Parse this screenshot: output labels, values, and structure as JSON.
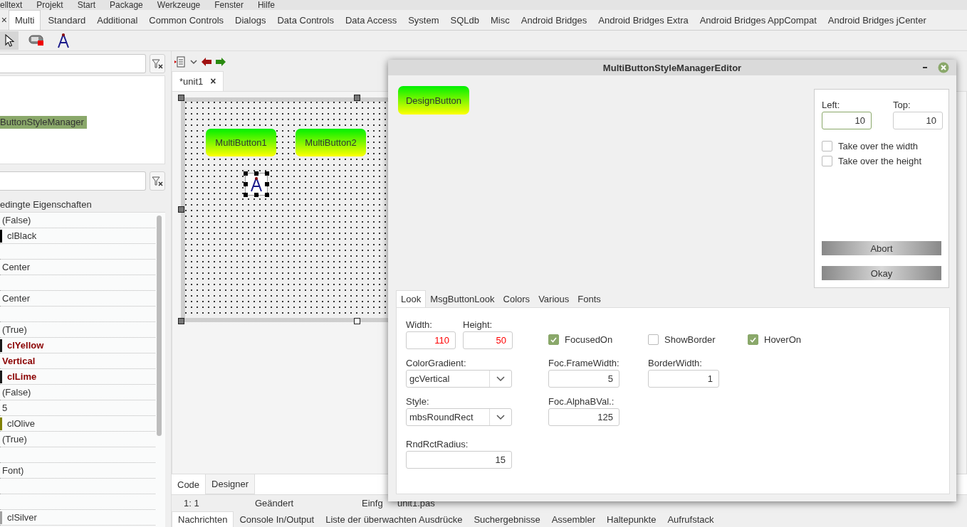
{
  "menu": [
    "elltext",
    "Projekt",
    "Start",
    "Package",
    "Werkzeuge",
    "Fenster",
    "Hilfe"
  ],
  "palette": {
    "close": "×",
    "tabs": [
      {
        "label": "Multi",
        "selected": true
      },
      {
        "label": "Standard",
        "selected": false
      },
      {
        "label": "Additional",
        "selected": false
      },
      {
        "label": "Common Controls",
        "selected": false
      },
      {
        "label": "Dialogs",
        "selected": false
      },
      {
        "label": "Data Controls",
        "selected": false
      },
      {
        "label": "Data Access",
        "selected": false
      },
      {
        "label": "System",
        "selected": false
      },
      {
        "label": "SQLdb",
        "selected": false
      },
      {
        "label": "Misc",
        "selected": false
      },
      {
        "label": "Android Bridges",
        "selected": false
      },
      {
        "label": "Android Bridges Extra",
        "selected": false
      },
      {
        "label": "Android Bridges AppCompat",
        "selected": false
      },
      {
        "label": "Android Bridges jCenter",
        "selected": false
      }
    ],
    "tools": [
      {
        "kind": "pointer",
        "selected": true
      },
      {
        "kind": "switch",
        "selected": false
      },
      {
        "kind": "compass",
        "selected": false
      }
    ]
  },
  "inspector": {
    "tree": [
      {
        "label": "ButtonStyleManager",
        "selected": true
      }
    ],
    "caption": "edingte Eigenschaften",
    "properties": [
      {
        "kind": "value",
        "value": "(False)",
        "modified": false
      },
      {
        "kind": "color",
        "value": "clBlack",
        "modified": false,
        "color": "#000000"
      },
      {
        "kind": "blank"
      },
      {
        "kind": "value",
        "value": "Center",
        "modified": false
      },
      {
        "kind": "blank"
      },
      {
        "kind": "value",
        "value": "Center",
        "modified": false
      },
      {
        "kind": "blank"
      },
      {
        "kind": "value",
        "value": "(True)",
        "modified": false
      },
      {
        "kind": "color",
        "value": "clYellow",
        "modified": true,
        "color": "#1a1a1a"
      },
      {
        "kind": "value",
        "value": "Vertical",
        "modified": true
      },
      {
        "kind": "color",
        "value": "clLime",
        "modified": true,
        "color": "#1a1a1a"
      },
      {
        "kind": "value",
        "value": "(False)",
        "modified": false
      },
      {
        "kind": "value",
        "value": "5",
        "modified": false
      },
      {
        "kind": "color",
        "value": "clOlive",
        "modified": false,
        "color": "#808000"
      },
      {
        "kind": "value",
        "value": "(True)",
        "modified": false
      },
      {
        "kind": "blank"
      },
      {
        "kind": "value",
        "value": "Font)",
        "modified": false
      },
      {
        "kind": "blank"
      },
      {
        "kind": "blank"
      },
      {
        "kind": "color",
        "value": "clSilver",
        "modified": false,
        "color": "#a0a0a0"
      }
    ]
  },
  "editor": {
    "tabs": [
      {
        "label": "*unit1",
        "close": "×",
        "selected": true
      }
    ],
    "form_buttons": [
      "MultiButton1",
      "MultiButton2"
    ],
    "view_tabs": [
      {
        "label": "Code",
        "selected": false
      },
      {
        "label": "Designer",
        "selected": true
      }
    ],
    "status": [
      "1:  1",
      "Geändert",
      "Einfg",
      "unit1.pas"
    ]
  },
  "messages_tabs": [
    {
      "label": "Nachrichten",
      "selected": true
    },
    {
      "label": "Console In/Output",
      "selected": false
    },
    {
      "label": "Liste der überwachten Ausdrücke",
      "selected": false
    },
    {
      "label": "Suchergebnisse",
      "selected": false
    },
    {
      "label": "Assembler",
      "selected": false
    },
    {
      "label": "Haltepunkte",
      "selected": false
    },
    {
      "label": "Aufrufstack",
      "selected": false
    }
  ],
  "dialog": {
    "title": "MultiButtonStyleManagerEditor",
    "design_button": "DesignButton",
    "position": [
      {
        "label": "Left:",
        "value": "10",
        "focused": true
      },
      {
        "label": "Top:",
        "value": "10",
        "focused": false
      }
    ],
    "options": [
      {
        "label": "Take over the width",
        "checked": false
      },
      {
        "label": "Take over the height",
        "checked": false
      }
    ],
    "actions": [
      "Abort",
      "Okay"
    ],
    "tabs": [
      {
        "label": "Look",
        "selected": true
      },
      {
        "label": "MsgButtonLook",
        "selected": false
      },
      {
        "label": "Colors",
        "selected": false
      },
      {
        "label": "Various",
        "selected": false
      },
      {
        "label": "Fonts",
        "selected": false
      }
    ],
    "look_rows": [
      [
        {
          "kind": "pair",
          "fields": [
            {
              "label": "Width:",
              "value": "110",
              "alert": true
            },
            {
              "label": "Height:",
              "value": "50",
              "alert": true
            }
          ]
        },
        {
          "kind": "check",
          "label": "FocusedOn",
          "checked": true
        },
        {
          "kind": "check",
          "label": "ShowBorder",
          "checked": false
        },
        {
          "kind": "check",
          "label": "HoverOn",
          "checked": true
        }
      ],
      [
        {
          "kind": "combo",
          "label": "ColorGradient:",
          "value": "gcVertical"
        },
        {
          "kind": "number",
          "label": "Foc.FrameWidth:",
          "value": "5",
          "alert": false
        },
        {
          "kind": "number",
          "label": "BorderWidth:",
          "value": "1",
          "alert": false
        }
      ],
      [
        {
          "kind": "combo",
          "label": "Style:",
          "value": "mbsRoundRect"
        },
        {
          "kind": "number",
          "label": "Foc.AlphaBVal.:",
          "value": "125",
          "alert": false
        }
      ],
      [
        {
          "kind": "number",
          "label": "RndRctRadius:",
          "value": "15",
          "alert": false
        }
      ]
    ]
  }
}
